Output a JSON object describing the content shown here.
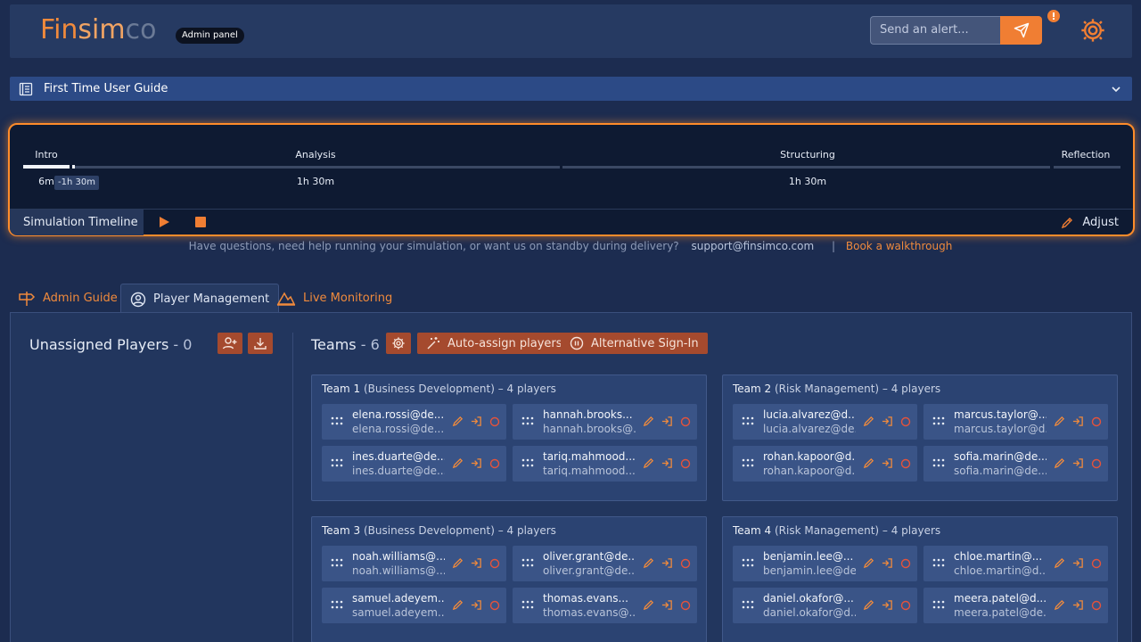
{
  "header": {
    "logo": {
      "part1": "Fin",
      "part2": "sim",
      "part3": "co"
    },
    "badge": "Admin panel",
    "alert_placeholder": "Send an alert...",
    "accent_color": "#f07e33"
  },
  "guide": {
    "label": "First Time User Guide"
  },
  "timeline": {
    "phases": [
      {
        "name": "Intro",
        "duration": "6m"
      },
      {
        "name": "Analysis",
        "duration": "1h 30m"
      },
      {
        "name": "Structuring",
        "duration": "1h 30m"
      },
      {
        "name": "Reflection",
        "duration": ""
      }
    ],
    "offset": "-1h 30m",
    "title": "Simulation Timeline",
    "adjust_label": "Adjust"
  },
  "support": {
    "text": "Have questions, need help running your simulation, or want us on standby during delivery?",
    "email": "support@finsimco.com",
    "separator": "|",
    "book": "Book a walkthrough"
  },
  "tabs": [
    {
      "label": "Admin Guide"
    },
    {
      "label": "Player Management"
    },
    {
      "label": "Live Monitoring"
    }
  ],
  "unassigned": {
    "title": "Unassigned Players",
    "count": "- 0"
  },
  "teams_section": {
    "title": "Teams",
    "count": "- 6",
    "auto_assign": "Auto-assign players",
    "alt_signin": "Alternative Sign-In"
  },
  "teams": [
    {
      "name": "Team 1",
      "desc": "(Business Development) – 4 players",
      "players": [
        {
          "email": "elena.rossi@de...",
          "sub": "elena.rossi@de..."
        },
        {
          "email": "hannah.brooks...",
          "sub": "hannah.brooks@..."
        },
        {
          "email": "ines.duarte@de...",
          "sub": "ines.duarte@de..."
        },
        {
          "email": "tariq.mahmood...",
          "sub": "tariq.mahmood..."
        }
      ]
    },
    {
      "name": "Team 2",
      "desc": "(Risk Management) – 4 players",
      "players": [
        {
          "email": "lucia.alvarez@d...",
          "sub": "lucia.alvarez@de..."
        },
        {
          "email": "marcus.taylor@...",
          "sub": "marcus.taylor@d..."
        },
        {
          "email": "rohan.kapoor@d...",
          "sub": "rohan.kapoor@d..."
        },
        {
          "email": "sofia.marin@de...",
          "sub": "sofia.marin@de..."
        }
      ]
    },
    {
      "name": "Team 3",
      "desc": "(Business Development) – 4 players",
      "players": [
        {
          "email": "noah.williams@...",
          "sub": "noah.williams@..."
        },
        {
          "email": "oliver.grant@de...",
          "sub": "oliver.grant@de..."
        },
        {
          "email": "samuel.adeyem...",
          "sub": "samuel.adeyem..."
        },
        {
          "email": "thomas.evans...",
          "sub": "thomas.evans@..."
        }
      ]
    },
    {
      "name": "Team 4",
      "desc": "(Risk Management) – 4 players",
      "players": [
        {
          "email": "benjamin.lee@...",
          "sub": "benjamin.lee@de..."
        },
        {
          "email": "chloe.martin@...",
          "sub": "chloe.martin@d..."
        },
        {
          "email": "daniel.okafor@...",
          "sub": "daniel.okafor@d..."
        },
        {
          "email": "meera.patel@d...",
          "sub": "meera.patel@de..."
        }
      ]
    }
  ]
}
